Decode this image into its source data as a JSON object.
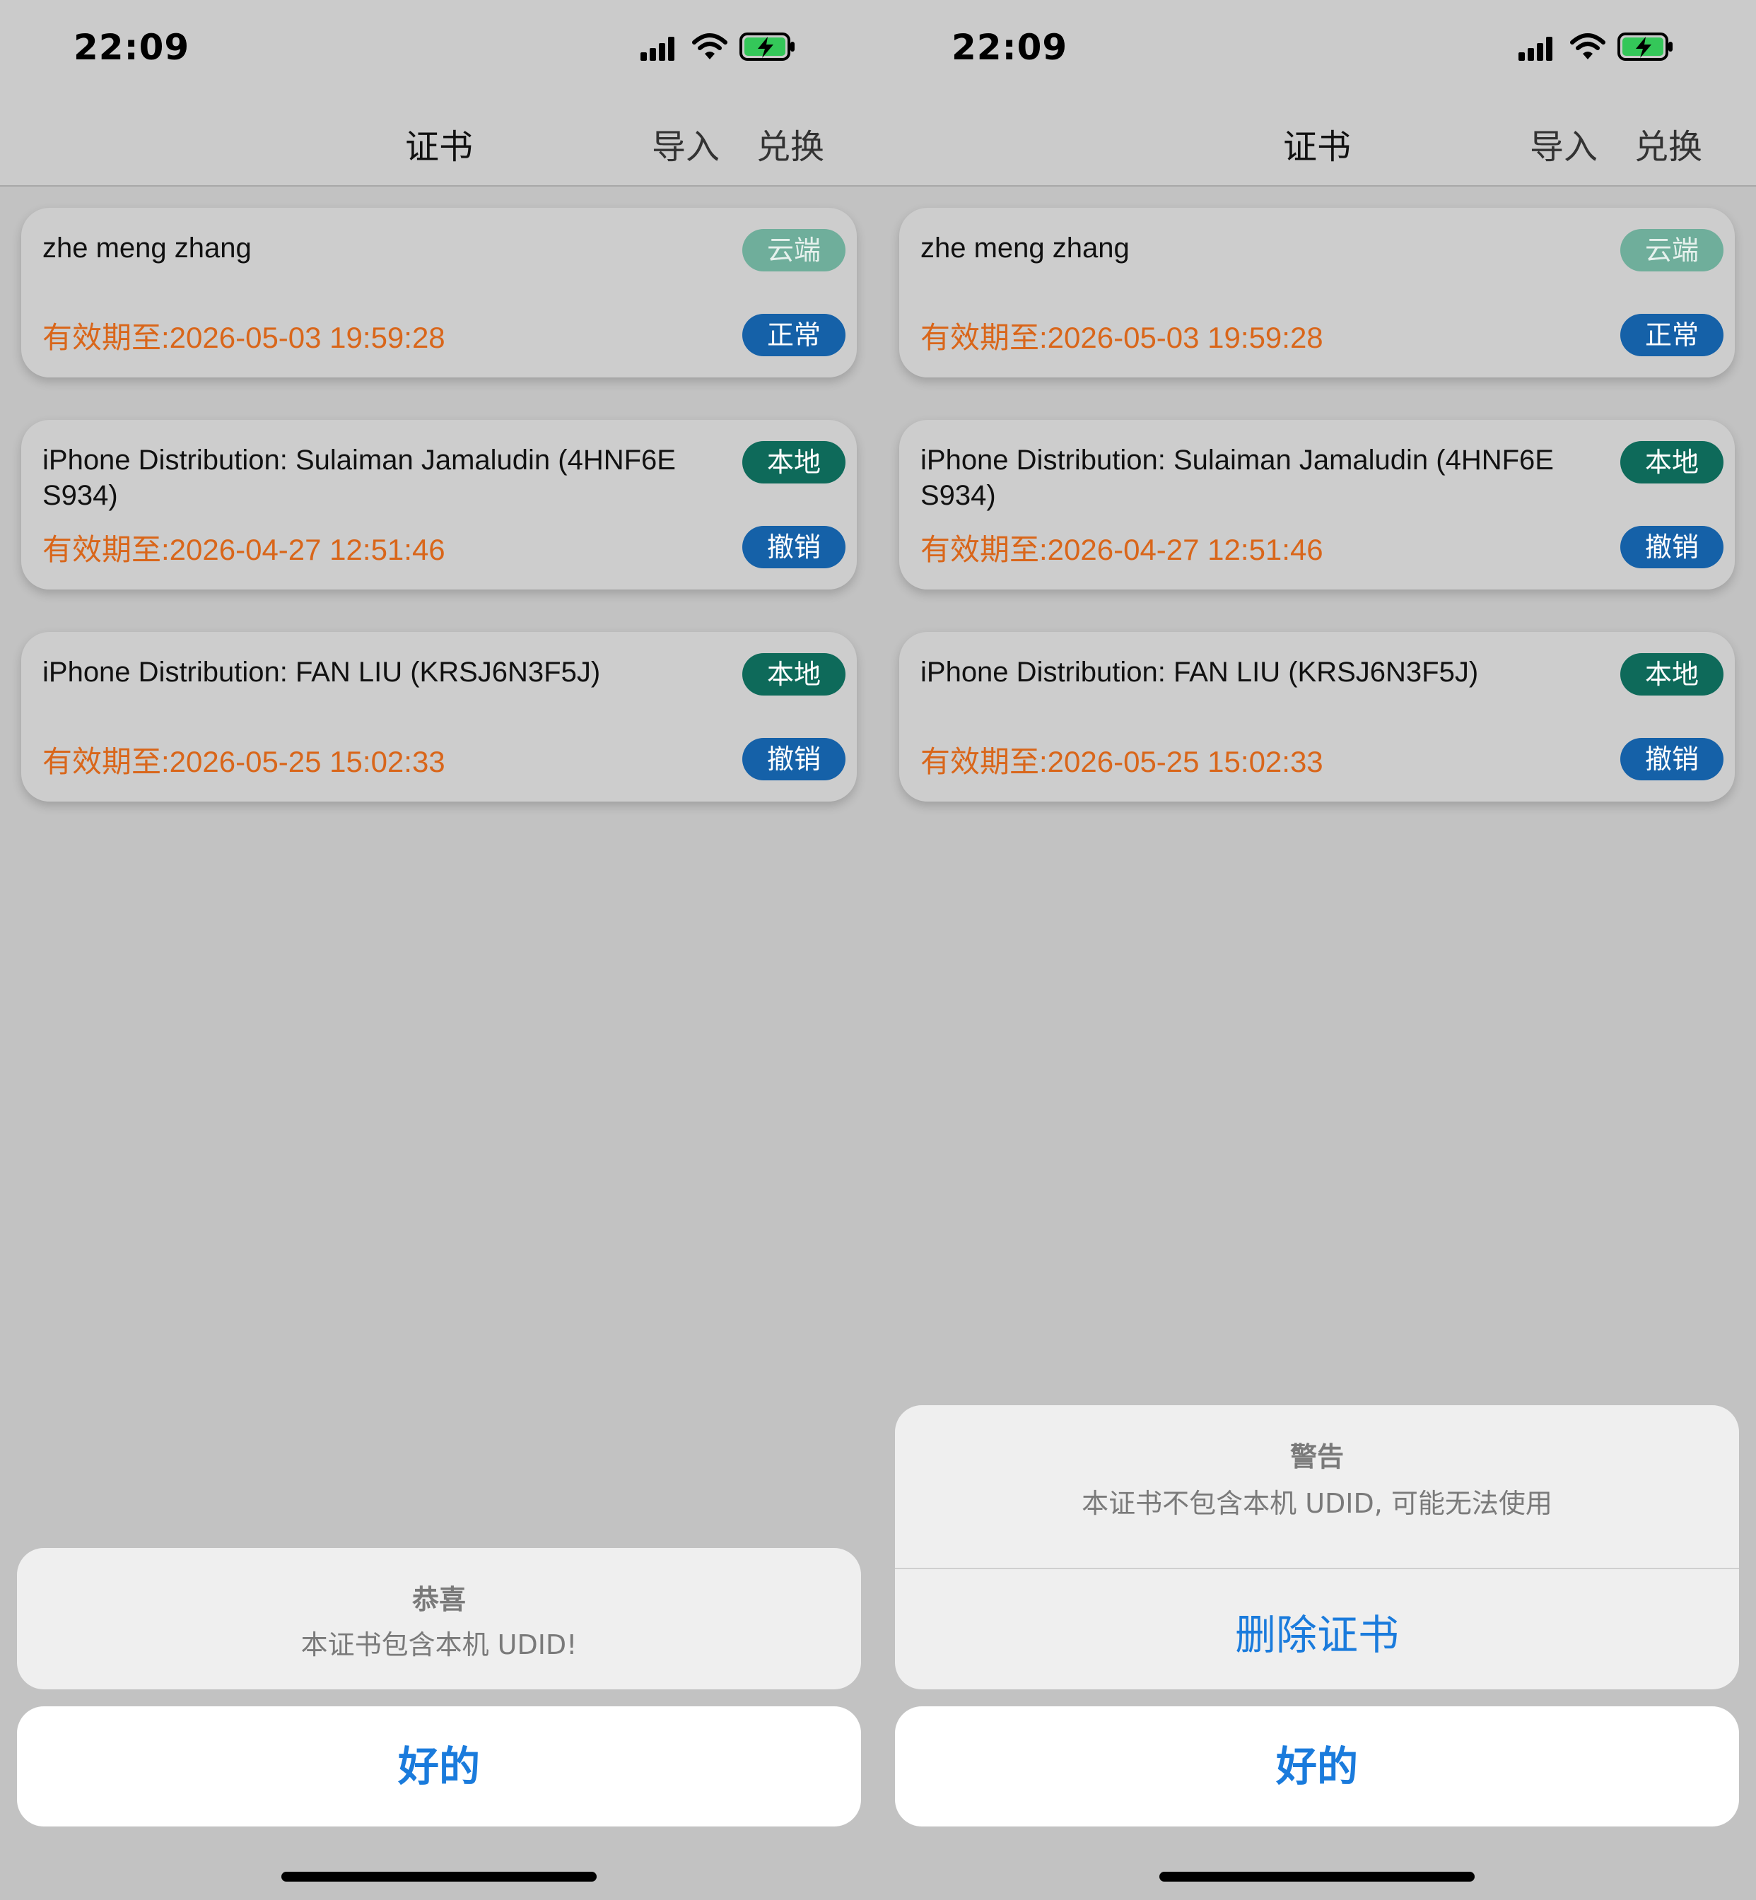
{
  "screens": [
    {
      "status": {
        "time": "22:09"
      },
      "nav": {
        "title": "证书",
        "import": "导入",
        "exchange": "兑换"
      },
      "certificates": [
        {
          "name": "zhe meng zhang",
          "expiry": "有效期至:2026-05-03 19:59:28",
          "source_badge": "云端",
          "status_badge": "正常"
        },
        {
          "name": "iPhone Distribution: Sulaiman Jamaludin (4HNF6E S934)",
          "expiry": "有效期至:2026-04-27 12:51:46",
          "source_badge": "本地",
          "status_badge": "撤销"
        },
        {
          "name": "iPhone Distribution: FAN LIU (KRSJ6N3F5J)",
          "expiry": "有效期至:2026-05-25 15:02:33",
          "source_badge": "本地",
          "status_badge": "撤销"
        }
      ],
      "sheet": {
        "title": "恭喜",
        "message": "本证书包含本机 UDID!"
      },
      "cancel": "好的"
    },
    {
      "status": {
        "time": "22:09"
      },
      "nav": {
        "title": "证书",
        "import": "导入",
        "exchange": "兑换"
      },
      "certificates": [
        {
          "name": "zhe meng zhang",
          "expiry": "有效期至:2026-05-03 19:59:28",
          "source_badge": "云端",
          "status_badge": "正常"
        },
        {
          "name": "iPhone Distribution: Sulaiman Jamaludin (4HNF6E S934)",
          "expiry": "有效期至:2026-04-27 12:51:46",
          "source_badge": "本地",
          "status_badge": "撤销"
        },
        {
          "name": "iPhone Distribution: FAN LIU (KRSJ6N3F5J)",
          "expiry": "有效期至:2026-05-25 15:02:33",
          "source_badge": "本地",
          "status_badge": "撤销"
        }
      ],
      "sheet": {
        "title": "警告",
        "message": "本证书不包含本机 UDID, 可能无法使用",
        "action": "删除证书"
      },
      "cancel": "好的"
    }
  ],
  "colors": {
    "expiry_text": "#d9661a",
    "badge_cloud": "#6fae9b",
    "badge_local": "#0e6a5a",
    "badge_normal": "#1561a8",
    "badge_revoked": "#1561a8",
    "action_blue": "#1a7bdc",
    "battery_green": "#34c759"
  },
  "icons": {
    "signal": "cellular-signal-icon",
    "wifi": "wifi-icon",
    "battery": "battery-charging-icon"
  }
}
